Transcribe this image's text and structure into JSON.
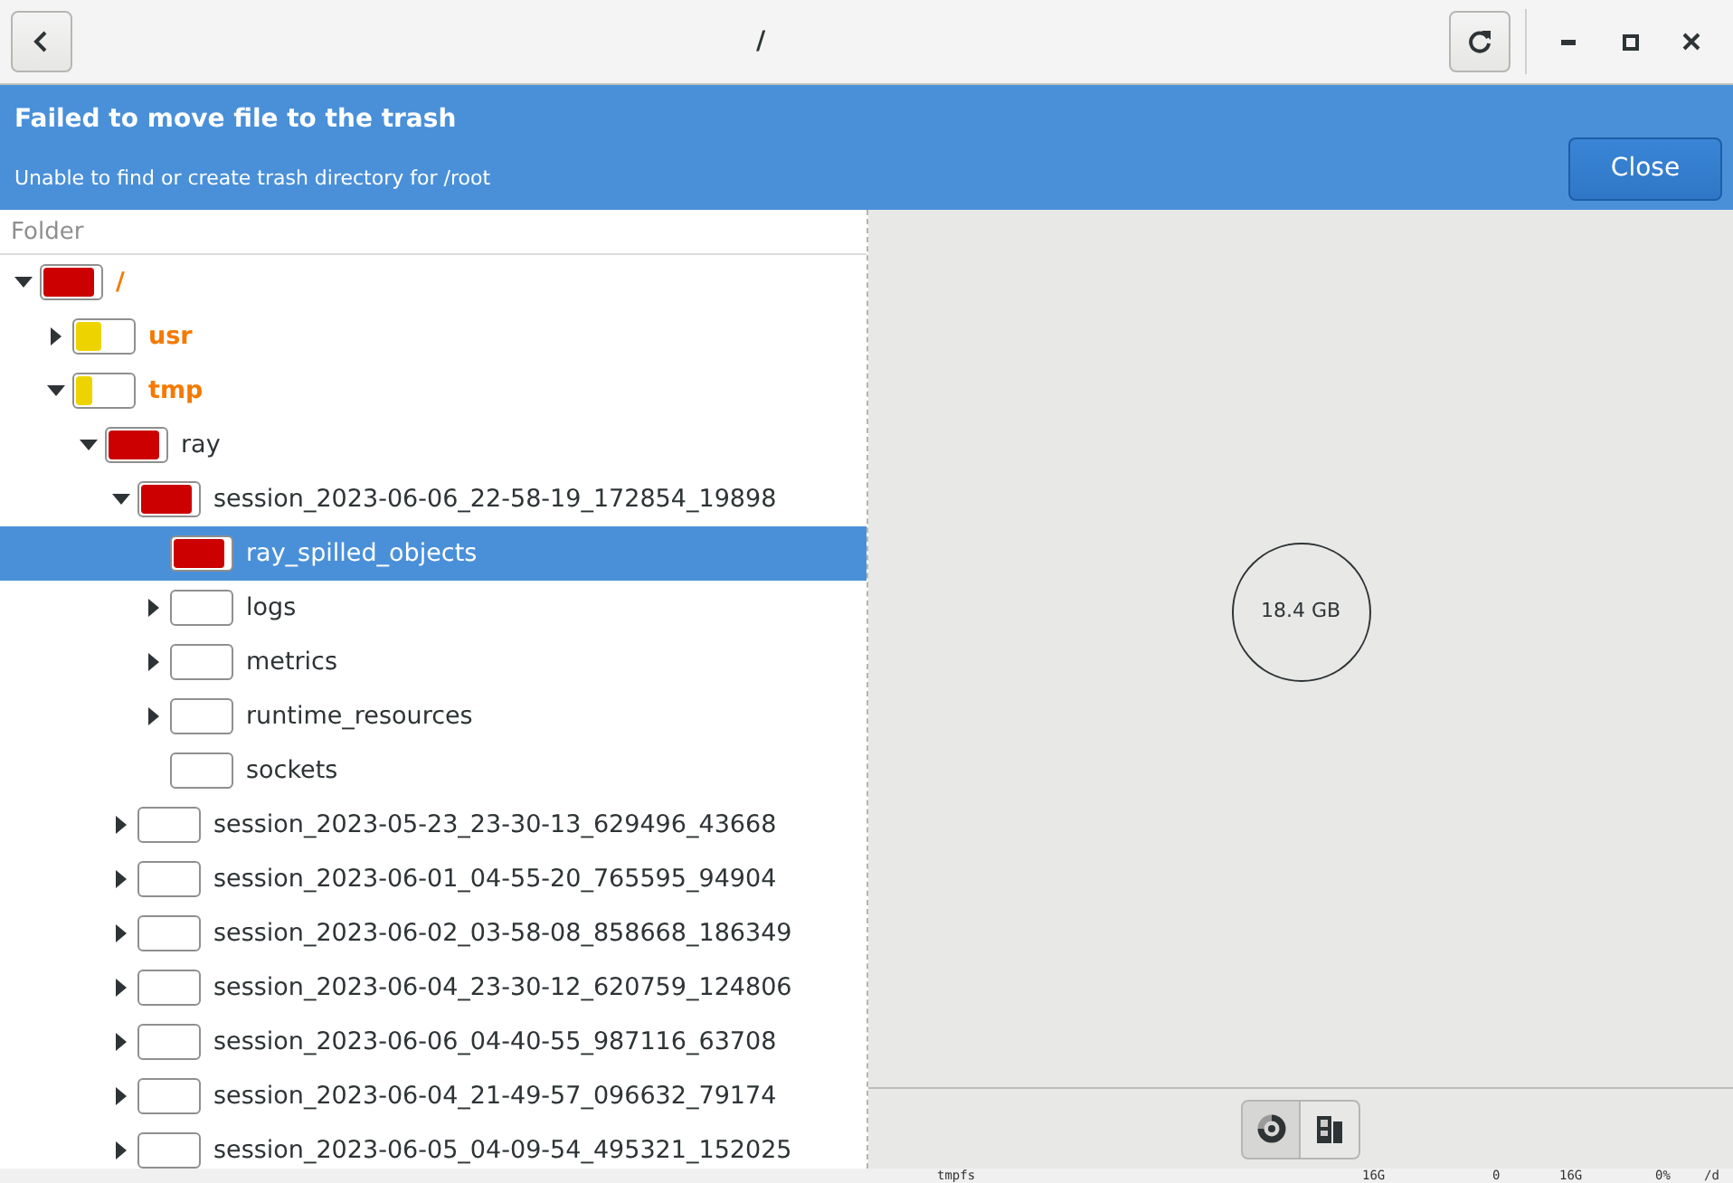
{
  "window": {
    "title": "/"
  },
  "infobar": {
    "title": "Failed to move file to the trash",
    "message": "Unable to find or create trash directory for /root",
    "button": "Close"
  },
  "tree": {
    "column": "Folder",
    "items": [
      {
        "name": "/",
        "highlighted": true,
        "expandable": true,
        "expanded": true,
        "selected": false,
        "level": 0.9,
        "color": "#cc0000",
        "children": [
          {
            "name": "usr",
            "highlighted": true,
            "expandable": true,
            "expanded": false,
            "selected": false,
            "level": 0.45,
            "color": "#edd400"
          },
          {
            "name": "tmp",
            "highlighted": true,
            "expandable": true,
            "expanded": true,
            "selected": false,
            "level": 0.3,
            "color": "#edd400",
            "children": [
              {
                "name": "ray",
                "highlighted": false,
                "expandable": true,
                "expanded": true,
                "selected": false,
                "level": 0.9,
                "color": "#cc0000",
                "children": [
                  {
                    "name": "session_2023-06-06_22-58-19_172854_19898",
                    "highlighted": false,
                    "expandable": true,
                    "expanded": true,
                    "selected": false,
                    "level": 0.9,
                    "color": "#cc0000",
                    "children": [
                      {
                        "name": "ray_spilled_objects",
                        "highlighted": false,
                        "expandable": false,
                        "selected": true,
                        "level": 0.9,
                        "color": "#cc0000"
                      },
                      {
                        "name": "logs",
                        "highlighted": false,
                        "expandable": true,
                        "expanded": false,
                        "selected": false
                      },
                      {
                        "name": "metrics",
                        "highlighted": false,
                        "expandable": true,
                        "expanded": false,
                        "selected": false
                      },
                      {
                        "name": "runtime_resources",
                        "highlighted": false,
                        "expandable": true,
                        "expanded": false,
                        "selected": false
                      },
                      {
                        "name": "sockets",
                        "highlighted": false,
                        "expandable": false,
                        "selected": false
                      }
                    ]
                  },
                  {
                    "name": "session_2023-05-23_23-30-13_629496_43668",
                    "highlighted": false,
                    "expandable": true,
                    "expanded": false,
                    "selected": false
                  },
                  {
                    "name": "session_2023-06-01_04-55-20_765595_94904",
                    "highlighted": false,
                    "expandable": true,
                    "expanded": false,
                    "selected": false
                  },
                  {
                    "name": "session_2023-06-02_03-58-08_858668_186349",
                    "highlighted": false,
                    "expandable": true,
                    "expanded": false,
                    "selected": false
                  },
                  {
                    "name": "session_2023-06-04_23-30-12_620759_124806",
                    "highlighted": false,
                    "expandable": true,
                    "expanded": false,
                    "selected": false
                  },
                  {
                    "name": "session_2023-06-06_04-40-55_987116_63708",
                    "highlighted": false,
                    "expandable": true,
                    "expanded": false,
                    "selected": false
                  },
                  {
                    "name": "session_2023-06-04_21-49-57_096632_79174",
                    "highlighted": false,
                    "expandable": true,
                    "expanded": false,
                    "selected": false
                  },
                  {
                    "name": "session_2023-06-05_04-09-54_495321_152025",
                    "highlighted": false,
                    "expandable": true,
                    "expanded": false,
                    "selected": false
                  }
                ]
              }
            ]
          }
        ]
      }
    ]
  },
  "chart": {
    "center_label": "18.4 GB"
  },
  "view_switcher": [
    {
      "kind": "rings",
      "selected": true
    },
    {
      "kind": "treemap",
      "selected": false
    }
  ],
  "background_terminal": [
    "tmpfs",
    "16G",
    "0",
    "16G",
    "0%",
    "/d"
  ]
}
